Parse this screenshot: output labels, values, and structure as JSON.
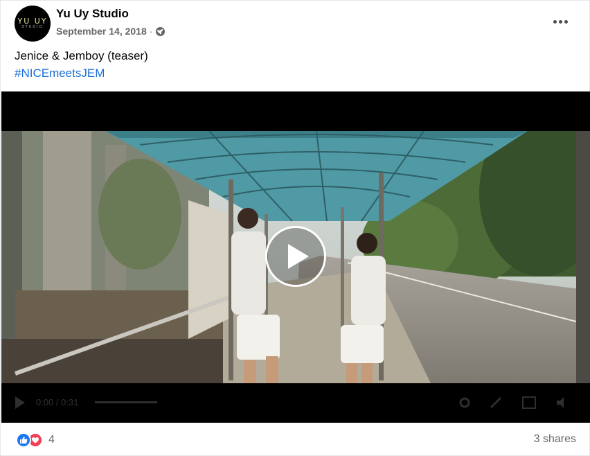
{
  "post": {
    "page_name": "Yu Uy Studio",
    "avatar_logo": "YU UY",
    "avatar_sub": "STUDIO",
    "date": "September 14, 2018",
    "separator": "·",
    "privacy_icon": "globe-icon",
    "more_icon": "more-options-icon",
    "caption": "Jenice & Jemboy (teaser)",
    "hashtag": "#NICEmeetsJEM"
  },
  "video": {
    "play_icon": "play-icon",
    "time": "0:00 / 0:31"
  },
  "footer": {
    "reaction_icons": [
      "like-icon",
      "love-icon"
    ],
    "reaction_count": "4",
    "shares": "3 shares"
  },
  "colors": {
    "link": "#1a6ed8",
    "secondary_text": "#65676b",
    "like": "#1877f2",
    "love": "#f33e58"
  }
}
